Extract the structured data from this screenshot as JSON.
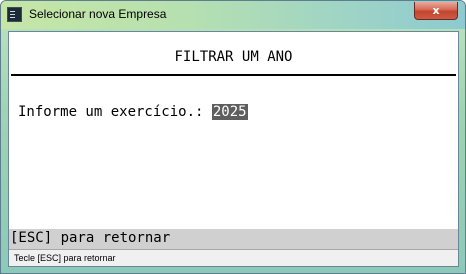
{
  "window": {
    "title": "Selecionar nova Empresa",
    "close_label": "x",
    "app_icon": "terminal-app-icon"
  },
  "screen": {
    "header_title": "FILTRAR UM ANO",
    "prompt_label": "Informe um exercício.: ",
    "year_value": "2025",
    "hint": "[ESC] para retornar"
  },
  "statusbar": {
    "text": "Tecle [ESC] para retornar"
  },
  "colors": {
    "input_highlight_bg": "#5e5e5e",
    "hint_bar_bg": "#d0d0d0",
    "close_button": "#c2442e"
  }
}
